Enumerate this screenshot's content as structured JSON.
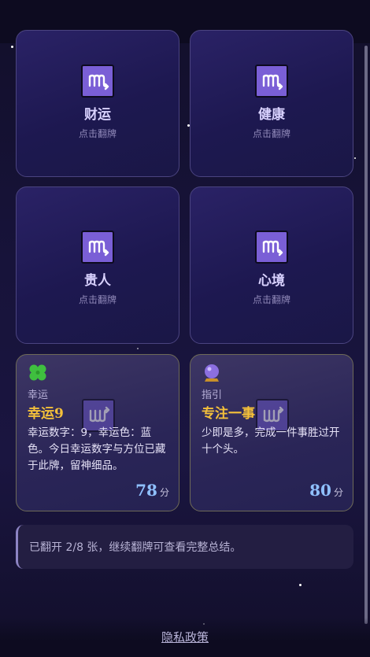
{
  "cards": [
    {
      "title": "财运",
      "hint": "点击翻牌",
      "icon": "scorpio-icon"
    },
    {
      "title": "健康",
      "hint": "点击翻牌",
      "icon": "scorpio-icon"
    },
    {
      "title": "贵人",
      "hint": "点击翻牌",
      "icon": "scorpio-icon"
    },
    {
      "title": "心境",
      "hint": "点击翻牌",
      "icon": "scorpio-icon"
    }
  ],
  "results": [
    {
      "icon": "four-leaf-clover-icon",
      "category": "幸运",
      "title": "幸运9",
      "text": "幸运数字：9，幸运色：蓝色。今日幸运数字与方位已藏于此牌，留神细品。",
      "score": "78",
      "unit": "分"
    },
    {
      "icon": "crystal-ball-icon",
      "category": "指引",
      "title": "专注一事",
      "text": "少即是多，完成一件事胜过开十个头。",
      "score": "80",
      "unit": "分"
    }
  ],
  "notice": "已翻开 2/8 张，继续翻牌可查看完整总结。",
  "footer": {
    "privacy": "隐私政策"
  },
  "colors": {
    "accent_gold": "#f4c03a",
    "score_blue": "#8fc0ff",
    "icon_purple": "#7a5fd6"
  }
}
